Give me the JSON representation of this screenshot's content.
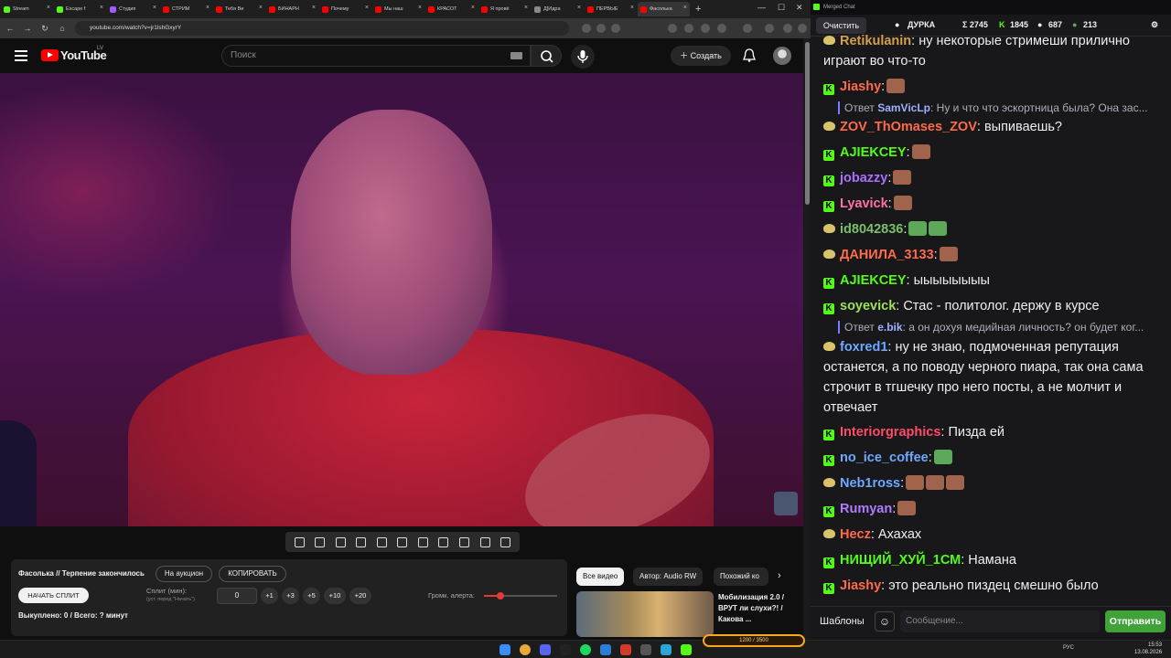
{
  "browser": {
    "tabs": [
      {
        "title": "Stream",
        "color": "#53fc18"
      },
      {
        "title": "Escape f",
        "color": "#53fc18"
      },
      {
        "title": "Студия",
        "color": "#a259ff"
      },
      {
        "title": "СТРИМ",
        "color": "#ff0000"
      },
      {
        "title": "Тебя Ви",
        "color": "#ff0000"
      },
      {
        "title": "БИНАРН",
        "color": "#ff0000"
      },
      {
        "title": "Почему",
        "color": "#ff0000"
      },
      {
        "title": "Мы наш",
        "color": "#ff0000"
      },
      {
        "title": "КРАСОТ",
        "color": "#ff0000"
      },
      {
        "title": "Я провё",
        "color": "#ff0000"
      },
      {
        "title": "Д[Идра",
        "color": "#888888"
      },
      {
        "title": "ПЕРВЫЕ",
        "color": "#ff0000"
      },
      {
        "title": "Фасолька",
        "color": "#ff0000"
      }
    ],
    "url": "youtube.com/watch?v=jr1lshGxyrY"
  },
  "youtube": {
    "logo_text": "YouTube",
    "country": "LV",
    "search_placeholder": "Поиск",
    "create_label": "Создать"
  },
  "widget": {
    "title": "Фасолька // Терпение закончилось",
    "auction_label": "На аукцион",
    "copy_label": "КОПИРОВАТЬ",
    "split_button": "НАЧАТЬ СПЛИТ",
    "split_label": "Сплит (мин):",
    "split_hint": "(уст. перед \"Начать\")",
    "split_value": "0",
    "increments": [
      "+1",
      "+3",
      "+5",
      "+10",
      "+20"
    ],
    "bought": "Выкуплено: 0 / Всего: ? минут",
    "volume_label": "Громк. алерта:",
    "volume_level": 0.22
  },
  "recommendations": {
    "chips": [
      "Все видео",
      "Автор: Audio RW",
      "Похожий ко"
    ],
    "video_title": "Мобилизация 2.0 / ВРУТ ли слухи?! / Какова ..."
  },
  "chat": {
    "window_title": "Merged Chat",
    "clear_label": "Очистить",
    "channel": "ДУРКА",
    "sum_label": "Σ 2745",
    "kick_count": "1845",
    "rumble_count": "687",
    "other_count": "213",
    "messages": [
      {
        "platform": "r",
        "nick": "Retikulanin",
        "color": "#d4a04c",
        "text": ": ну некоторые стримеши прилично играют во что-то",
        "emotes": 0
      },
      {
        "platform": "k",
        "nick": "Jiashy",
        "color": "#ff6b4a",
        "text": ":",
        "emotes": 1
      },
      {
        "platform": "r",
        "nick": "ZOV_ThOmases_ZOV",
        "color": "#ff6b4a",
        "text": ": выпиваешь?",
        "emotes": 0
      },
      {
        "platform": "k",
        "nick": "AJIEKCEY",
        "color": "#53fc18",
        "text": ":",
        "emotes": 1
      },
      {
        "platform": "k",
        "nick": "jobazzy",
        "color": "#a970ff",
        "text": ":",
        "emotes": 1
      },
      {
        "platform": "k",
        "nick": "Lyavick",
        "color": "#ff6fa8",
        "text": ":",
        "emotes": 1
      },
      {
        "platform": "r",
        "nick": "id8042836",
        "color": "#7bbf6a",
        "text": ":",
        "emotes": 2
      },
      {
        "platform": "r",
        "nick": "ДАНИЛА_3133",
        "color": "#ff6b4a",
        "text": ":",
        "emotes": 1
      },
      {
        "platform": "k",
        "nick": "AJIEKCEY",
        "color": "#53fc18",
        "text": ": ыыыыыыыы",
        "emotes": 0
      },
      {
        "platform": "k",
        "nick": "soyevick",
        "color": "#9de05a",
        "text": ": Стас - политолог. держу в курсе",
        "emotes": 0
      },
      {
        "platform": "r",
        "nick": "foxred1",
        "color": "#6fa8ff",
        "text": ": ну не знаю, подмоченная репутация останется, а по поводу черного пиара, так она сама строчит в тгшечку про него посты, а не молчит и отвечает",
        "emotes": 0
      },
      {
        "platform": "k",
        "nick": "Interiorgraphics",
        "color": "#ff4a6a",
        "text": ": Пизда ей",
        "emotes": 0
      },
      {
        "platform": "k",
        "nick": "no_ice_coffee",
        "color": "#6fa8ff",
        "text": ":",
        "emotes": 1
      },
      {
        "platform": "r",
        "nick": "Neb1ross",
        "color": "#6fa8ff",
        "text": ":",
        "emotes": 3
      },
      {
        "platform": "k",
        "nick": "Rumyan",
        "color": "#b07bff",
        "text": ":",
        "emotes": 1
      },
      {
        "platform": "r",
        "nick": "Hecz",
        "color": "#ff6b4a",
        "text": ": Ахахах",
        "emotes": 0
      },
      {
        "platform": "k",
        "nick": "НИЩИЙ_ХУЙ_1СМ",
        "color": "#53fc18",
        "text": ": Намана",
        "emotes": 0
      },
      {
        "platform": "k",
        "nick": "Jiashy",
        "color": "#ff6b4a",
        "text": ": это реально пиздец смешно было",
        "emotes": 0
      }
    ],
    "replies": [
      {
        "prefix": "Ответ",
        "nick": "SamVicLp",
        "text": ": Ну и что что эскортница была? Она зас..."
      },
      {
        "prefix": "Ответ",
        "nick": "e.bik",
        "text": ": а он дохуя медийная личность? он будет ког..."
      }
    ],
    "templates_label": "Шаблоны",
    "input_placeholder": "Сообщение...",
    "send_label": "Отправить"
  },
  "taskbar": {
    "kick_progress_text": "1200 / 3500",
    "kick_progress": 0.34,
    "lang": "РУС",
    "time": "15:53",
    "date": "13.08.2026"
  }
}
